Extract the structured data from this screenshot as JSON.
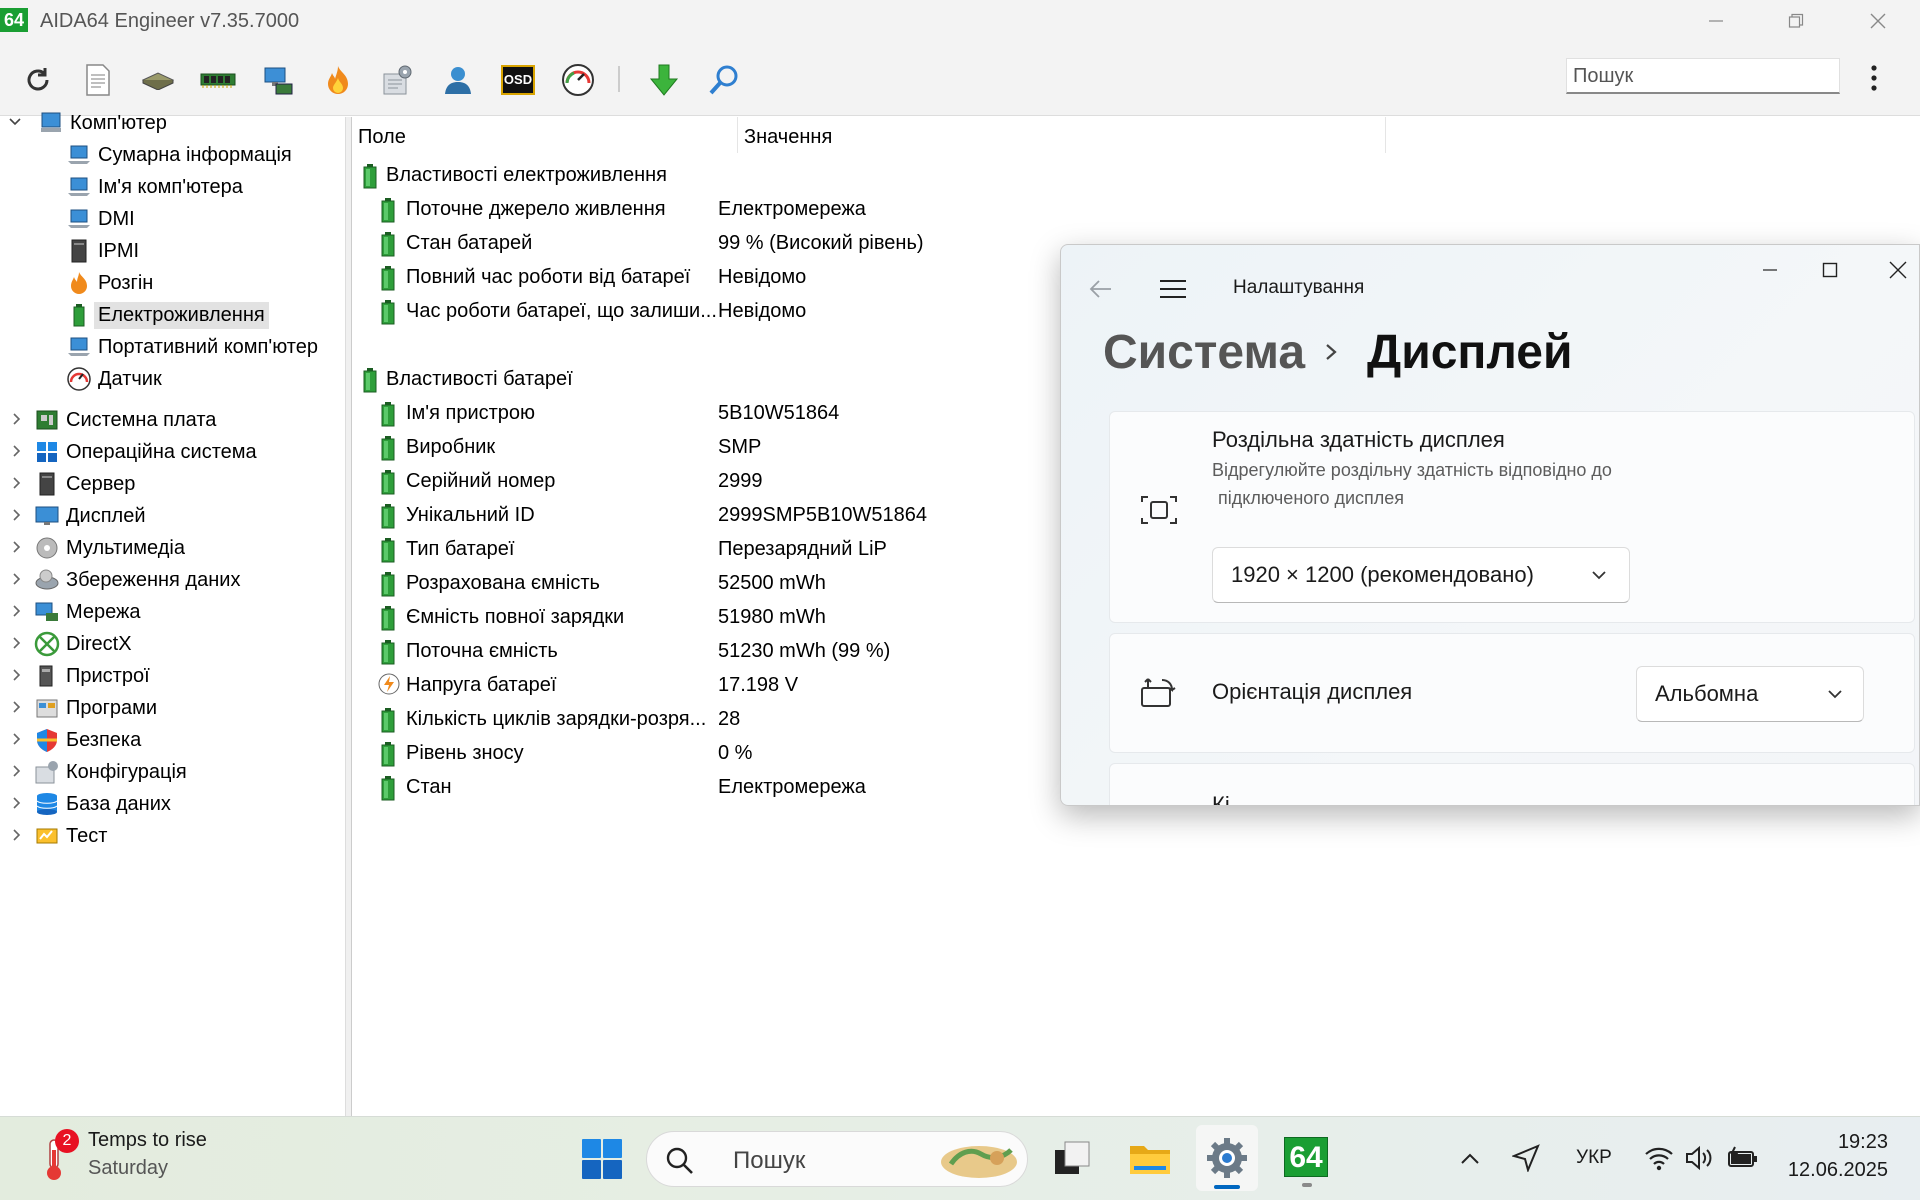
{
  "window": {
    "title": "AIDA64 Engineer v7.35.7000",
    "logo": "64"
  },
  "search": {
    "placeholder": "Пошук"
  },
  "toolbar_icons": [
    "refresh-icon",
    "report-icon",
    "motherboard-icon",
    "memory-icon",
    "network-icon",
    "flame-icon",
    "config-icon",
    "user-icon",
    "osd-icon",
    "gauge-icon",
    "download-icon",
    "search-icon"
  ],
  "osd_label": "OSD",
  "tree": {
    "root": "Комп'ютер",
    "children": [
      "Сумарна інформація",
      "Ім'я комп'ютера",
      "DMI",
      "IPMI",
      "Розгін",
      "Електроживлення",
      "Портативний комп'ютер",
      "Датчик"
    ],
    "selected": "Електроживлення",
    "groups": [
      "Системна плата",
      "Операційна система",
      "Сервер",
      "Дисплей",
      "Мультимедіа",
      "Збереження даних",
      "Мережа",
      "DirectX",
      "Пристрої",
      "Програми",
      "Безпека",
      "Конфігурація",
      "База даних",
      "Тест"
    ]
  },
  "list": {
    "col_field": "Поле",
    "col_value": "Значення",
    "section1": "Властивості електроживлення",
    "power_rows": [
      {
        "field": "Поточне джерело живлення",
        "value": "Електромережа"
      },
      {
        "field": "Стан батарей",
        "value": "99 % (Високий рівень)"
      },
      {
        "field": "Повний час роботи від батареї",
        "value": "Невідомо"
      },
      {
        "field": "Час роботи батареї, що залиши...",
        "value": "Невідомо"
      }
    ],
    "section2": "Властивості батареї",
    "battery_rows": [
      {
        "field": "Ім'я пристрою",
        "value": "5B10W51864"
      },
      {
        "field": "Виробник",
        "value": "SMP"
      },
      {
        "field": "Серійний номер",
        "value": "2999"
      },
      {
        "field": "Унікальний ID",
        "value": "2999SMP5B10W51864"
      },
      {
        "field": "Тип батареї",
        "value": "Перезарядний LiP"
      },
      {
        "field": "Розрахована ємність",
        "value": "52500 mWh"
      },
      {
        "field": "Ємність повної зарядки",
        "value": "51980 mWh"
      },
      {
        "field": "Поточна ємність",
        "value": "51230 mWh  (99 %)"
      },
      {
        "field": "Напруга батареї",
        "value": "17.198 V"
      },
      {
        "field": "Кількість циклів зарядки-розря...",
        "value": "28"
      },
      {
        "field": "Рівень зносу",
        "value": "0 %"
      },
      {
        "field": "Стан",
        "value": "Електромережа"
      }
    ]
  },
  "settings": {
    "title": "Налаштування",
    "crumb_parent": "Система",
    "crumb_current": "Дисплей",
    "resolution": {
      "title": "Роздільна здатність дисплея",
      "subtitle_line1": "Відрегулюйте роздільну здатність відповідно до",
      "subtitle_line2": "підключеного дисплея",
      "value": "1920 × 1200 (рекомендовано)"
    },
    "orientation": {
      "title": "Орієнтація дисплея",
      "value": "Альбомна"
    },
    "next_card_partial": "Кі..."
  },
  "taskbar": {
    "weather_badge": "2",
    "weather_title": "Temps to rise",
    "weather_sub": "Saturday",
    "search_placeholder": "Пошук",
    "aida_label": "64",
    "language": "УКР",
    "time": "19:23",
    "date": "12.06.2025"
  },
  "colors": {
    "aida_green": "#1a9e33",
    "accent": "#0067c0",
    "selection": "#e2e2e2"
  }
}
